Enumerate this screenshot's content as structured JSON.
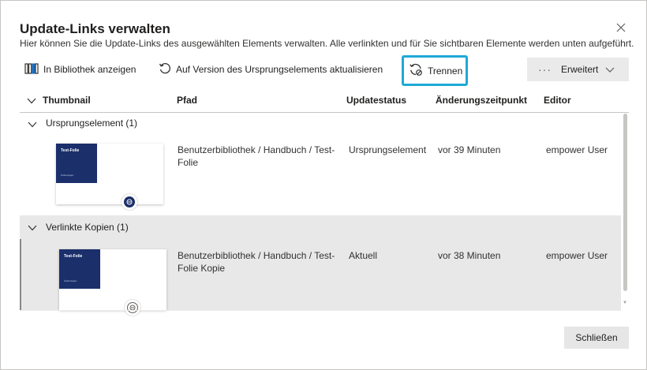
{
  "dialog": {
    "title": "Update-Links verwalten",
    "subtitle": "Hier können Sie die Update-Links des ausgewählten Elements verwalten. Alle verlinkten und für Sie sichtbaren Elemente werden unten aufgeführt."
  },
  "toolbar": {
    "show_in_library": "In Bibliothek anzeigen",
    "update_to_origin": "Auf Version des Ursprungselements aktualisieren",
    "disconnect": "Trennen",
    "more_dots": "···",
    "advanced": "Erweitert"
  },
  "table": {
    "columns": [
      "Thumbnail",
      "Pfad",
      "Updatestatus",
      "Änderungszeitpunkt",
      "Editor"
    ],
    "groups": [
      {
        "label": "Ursprungselement (1)",
        "rows": [
          {
            "slide_title": "Test-Folie",
            "slide_subtitle": "Änderungen",
            "path": "Benutzerbibliothek / Handbuch / Test-Folie",
            "status": "Ursprungselement",
            "changed": "vor 39 Minuten",
            "editor": "empower User"
          }
        ]
      },
      {
        "label": "Verlinkte Kopien (1)",
        "rows": [
          {
            "slide_title": "Test-Folie",
            "slide_subtitle": "Änderungen",
            "path": "Benutzerbibliothek / Handbuch / Test-Folie Kopie",
            "status": "Aktuell",
            "changed": "vor 38 Minuten",
            "editor": "empower User"
          }
        ]
      }
    ]
  },
  "footer": {
    "close_label": "Schließen"
  },
  "colors": {
    "accent_highlight": "#1ea9d6",
    "slide_blue": "#1b2f6b",
    "selected_row": "#e8e8e8"
  },
  "icons": [
    "close-icon",
    "library-icon",
    "refresh-icon",
    "unlink-icon",
    "more-icon",
    "chevron-down-icon",
    "link-badge-icon"
  ]
}
